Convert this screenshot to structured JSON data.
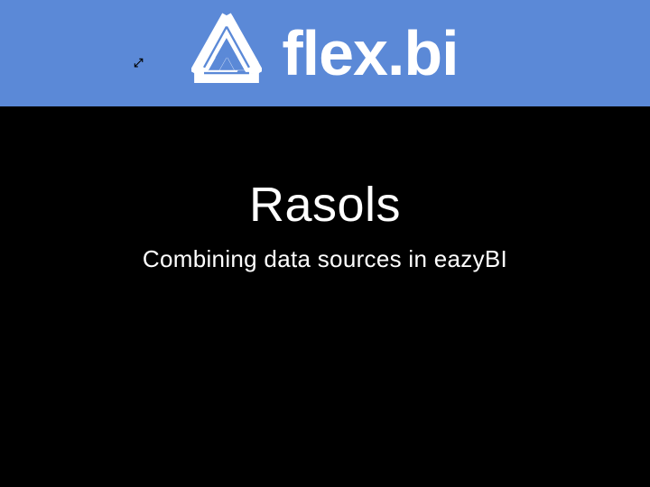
{
  "header": {
    "brand_text": "flex.bi",
    "band_color": "#5b89d7"
  },
  "slide": {
    "title": "Rasols",
    "subtitle": "Combining data sources in eazyBI"
  }
}
